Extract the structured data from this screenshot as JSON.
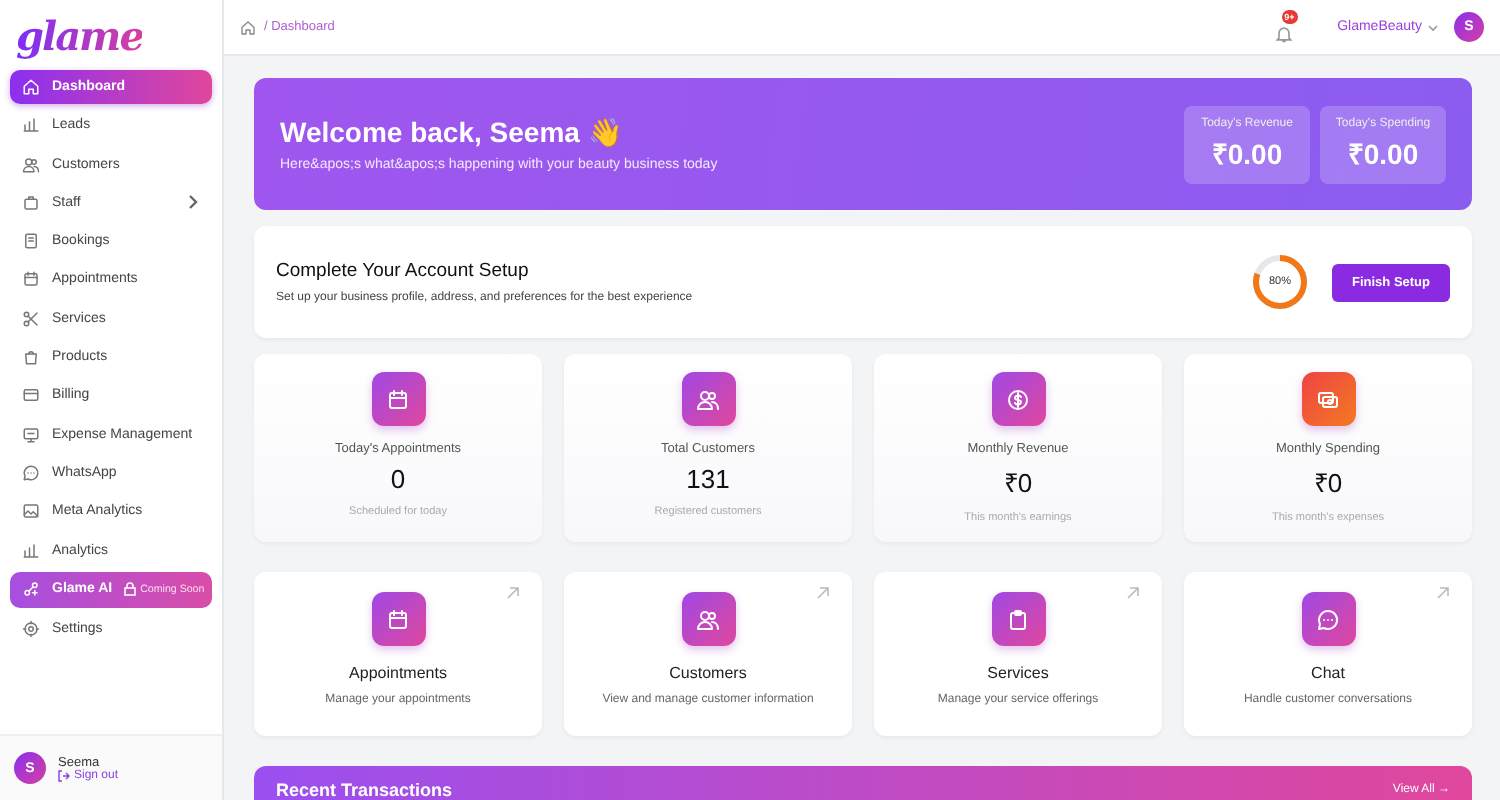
{
  "sidebar": {
    "logo": "glame",
    "items": [
      {
        "label": "Dashboard",
        "kind": "link",
        "selected": true
      },
      {
        "label": "Leads",
        "kind": "link",
        "selected": false
      },
      {
        "label": "Customers",
        "kind": "link",
        "selected": false
      },
      {
        "label": "Staff",
        "kind": "submenu",
        "selected": false
      },
      {
        "label": "Bookings",
        "kind": "link",
        "selected": false
      },
      {
        "label": "Appointments",
        "kind": "link",
        "selected": false
      },
      {
        "label": "Services",
        "kind": "link",
        "selected": false
      },
      {
        "label": "Products",
        "kind": "link",
        "selected": false
      },
      {
        "label": "Billing",
        "kind": "link",
        "selected": false
      },
      {
        "label": "Expense Management",
        "kind": "link",
        "selected": false
      },
      {
        "label": "WhatsApp",
        "kind": "link",
        "selected": false
      },
      {
        "label": "Meta Analytics",
        "kind": "link",
        "selected": false
      },
      {
        "label": "Analytics",
        "kind": "link",
        "selected": false
      },
      {
        "label": "Glame AI",
        "kind": "ai",
        "badge": "Coming Soon",
        "selected": false
      },
      {
        "label": "Settings",
        "kind": "link",
        "selected": false
      }
    ],
    "user": {
      "avatar": "S",
      "name": "Seema",
      "sign_out": "Sign out"
    }
  },
  "header": {
    "breadcrumb": "/ Dashboard",
    "notification_badge": "9+",
    "account": "GlameBeauty",
    "avatar": "S"
  },
  "welcome": {
    "title": "Welcome back, Seema 👋",
    "subtitle": "Here&apos;s what&apos;s happening with your beauty business today",
    "metrics": [
      {
        "label": "Today's Revenue",
        "value": "₹0.00"
      },
      {
        "label": "Today's Spending",
        "value": "₹0.00"
      }
    ]
  },
  "setup": {
    "title": "Complete Your Account Setup",
    "subtitle": "Set up your business profile, address, and preferences for the best experience",
    "progress_label": "80%",
    "level": 0.8,
    "button": "Finish Setup"
  },
  "stats": [
    {
      "kind": "calendar",
      "label": "Today's Appointments",
      "value": "0",
      "note": "Scheduled for today"
    },
    {
      "kind": "users",
      "label": "Total Customers",
      "value": "131",
      "note": "Registered customers"
    },
    {
      "kind": "dollar",
      "label": "Monthly Revenue",
      "value": "₹0",
      "note": "This month's earnings"
    },
    {
      "kind": "cash",
      "label": "Monthly Spending",
      "value": "₹0",
      "note": "This month's expenses"
    }
  ],
  "shortcuts": [
    {
      "kind": "calendar",
      "title": "Appointments",
      "description": "Manage your appointments"
    },
    {
      "kind": "users",
      "title": "Customers",
      "description": "View and manage customer information"
    },
    {
      "kind": "clipboard",
      "title": "Services",
      "description": "Manage your service offerings"
    },
    {
      "kind": "chat",
      "title": "Chat",
      "description": "Handle customer conversations"
    }
  ],
  "transactions": {
    "title": "Recent Transactions",
    "link": "View All →"
  }
}
